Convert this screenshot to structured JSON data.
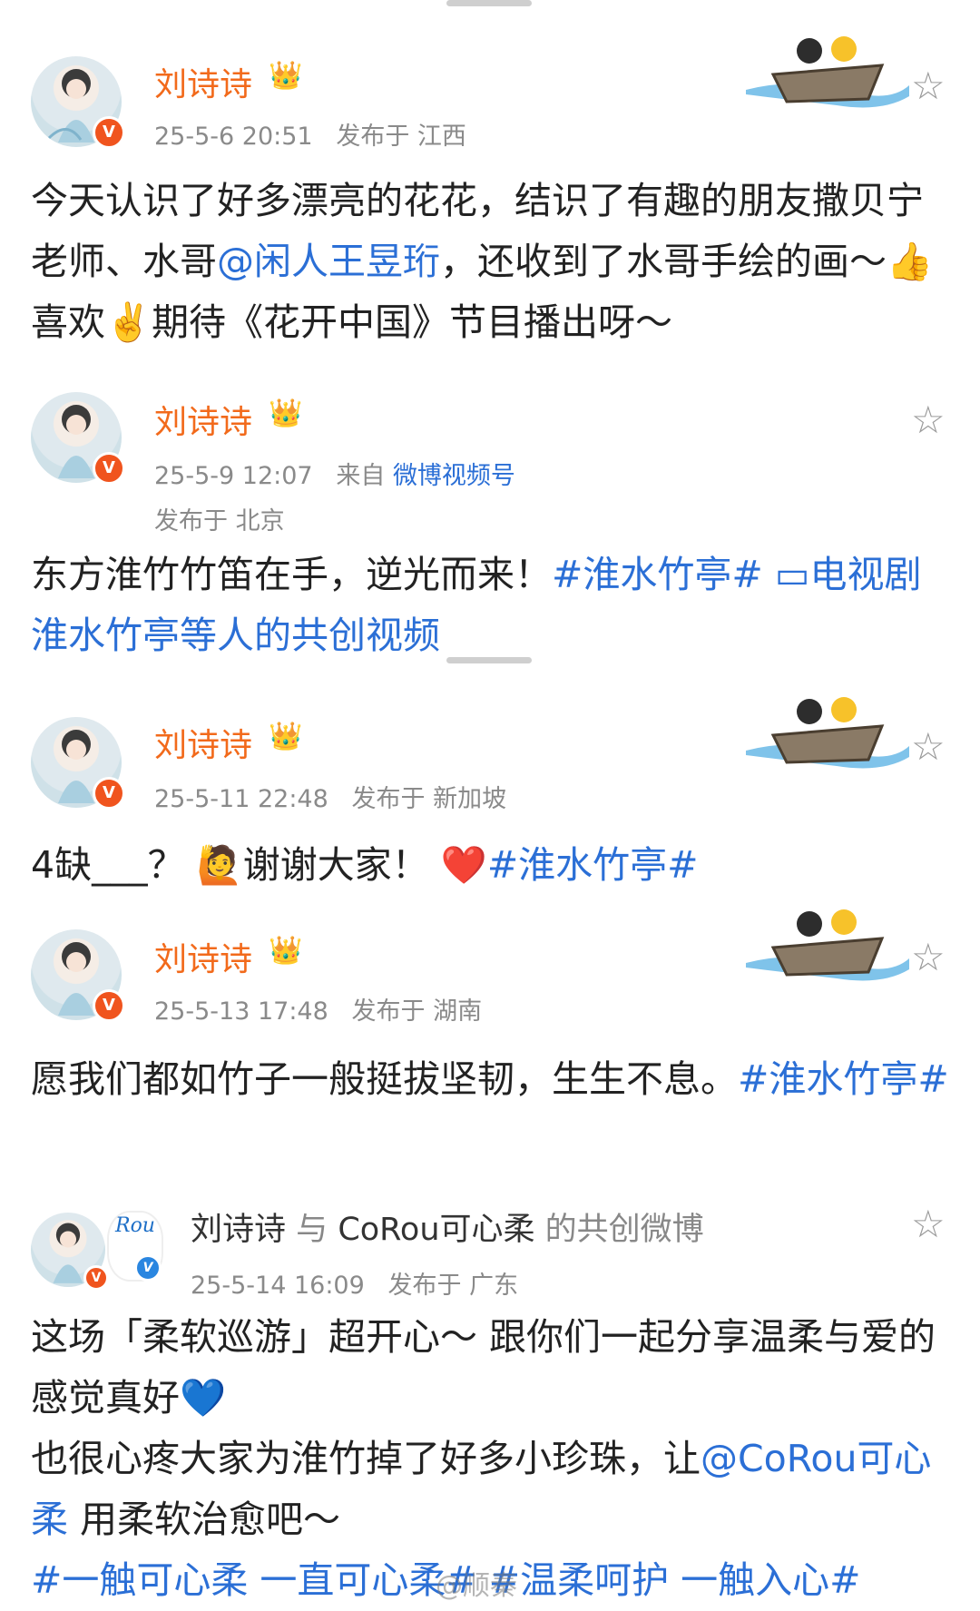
{
  "posts": [
    {
      "name": "刘诗诗",
      "crown": "👑",
      "time": "25-5-6 20:51",
      "location": "发布于 江西",
      "text_a": "今天认识了好多漂亮的花花，结识了有趣的朋友撒贝宁老师、水哥",
      "mention": "@闲人王昱珩",
      "text_b": "，还收到了水哥手绘的画～",
      "emoji1": "👍",
      "text_c": "喜欢",
      "emoji2": "✌️",
      "text_d": "期待《花开中国》节目播出呀～"
    },
    {
      "name": "刘诗诗",
      "crown": "👑",
      "time": "25-5-9 12:07",
      "from_label": "来自",
      "source": "微博视频号",
      "location": "发布于 北京",
      "text_a": "东方淮竹竹笛在手，逆光而来！",
      "hashtag": "#淮水竹亭#",
      "video_icon": "▭",
      "video_link": "电视剧淮水竹亭等人的共创视频"
    },
    {
      "name": "刘诗诗",
      "crown": "👑",
      "time": "25-5-11 22:48",
      "location": "发布于 新加坡",
      "text_a": "4缺___？",
      "emoji1": "🙋",
      "text_b": "谢谢大家！",
      "emoji2": "❤️",
      "hashtag": "#淮水竹亭#"
    },
    {
      "name": "刘诗诗",
      "crown": "👑",
      "time": "25-5-13 17:48",
      "location": "发布于 湖南",
      "text_a": "愿我们都如竹子一般挺拔坚韧，生生不息。",
      "hashtag": "#淮水竹亭#"
    },
    {
      "name": "刘诗诗",
      "connector": "与",
      "coauthor": "CoRou可心柔",
      "suffix": "的共创微博",
      "coauthor_logo": "Rou",
      "time": "25-5-14 16:09",
      "location": "发布于 广东",
      "text_a": "这场「柔软巡游」超开心～ 跟你们一起分享温柔与爱的感觉真好",
      "emoji1": "💙",
      "text_b": "也很心疼大家为淮竹掉了好多小珍珠，让",
      "mention": "@CoRou可心柔",
      "text_c": " 用柔软治愈吧～",
      "hashtags": "#一触可心柔 一直可心柔# #温柔呵护 一触入心#"
    }
  ],
  "icons": {
    "star": "star-outline-icon",
    "verified": "verified-badge-icon",
    "boat": "boat-sticker-icon"
  },
  "star_glyph": "☆",
  "verified_glyph": "V",
  "watermark": "@顺秦"
}
